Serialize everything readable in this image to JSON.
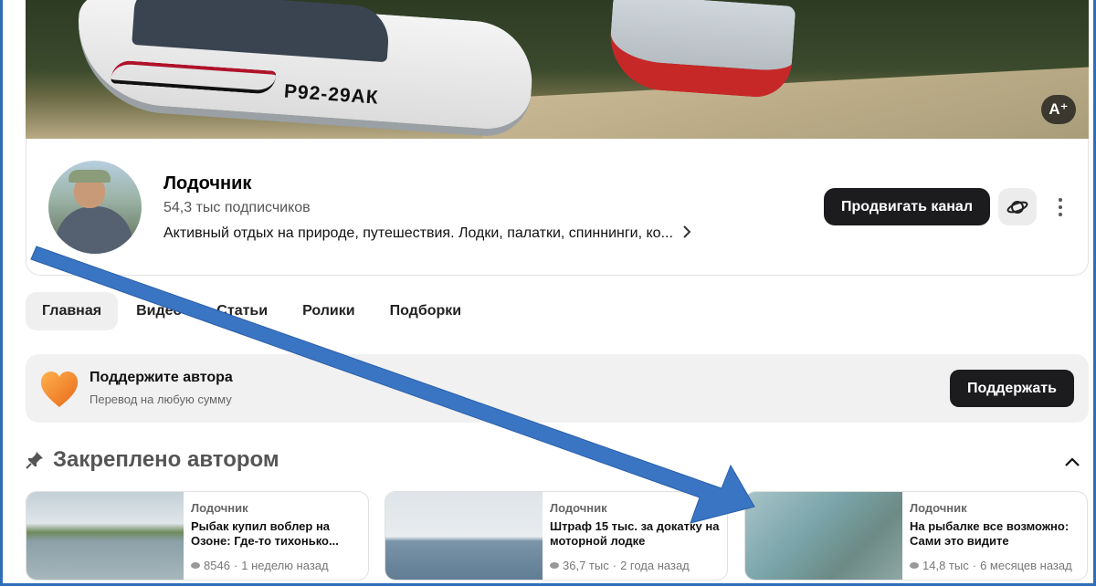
{
  "banner": {
    "plate": "Р92-29АК",
    "ai_badge": "A⁺"
  },
  "channel": {
    "name": "Лодочник",
    "subscribers": "54,3 тыс подписчиков",
    "description": "Активный отдых на природе, путешествия. Лодки, палатки, спиннинги, ко...",
    "promote_label": "Продвигать канал"
  },
  "tabs": [
    {
      "label": "Главная"
    },
    {
      "label": "Видео"
    },
    {
      "label": "Статьи"
    },
    {
      "label": "Ролики"
    },
    {
      "label": "Подборки"
    }
  ],
  "support": {
    "title": "Поддержите автора",
    "subtitle": "Перевод на любую сумму",
    "button": "Поддержать"
  },
  "pinned": {
    "title": "Закреплено автором",
    "cards": [
      {
        "author": "Лодочник",
        "title": "Рыбак купил воблер на Озоне: Где-то тихонько...",
        "views": "8546",
        "time": "1 неделю назад"
      },
      {
        "author": "Лодочник",
        "title": "Штраф 15 тыс. за докатку на моторной лодке",
        "views": "36,7 тыс",
        "time": "2 года назад"
      },
      {
        "author": "Лодочник",
        "title": "На рыбалке все возможно: Сами это видите",
        "views": "14,8 тыс",
        "time": "6 месяцев назад"
      }
    ]
  },
  "colors": {
    "accent_dark": "#1c1c1f",
    "arrow": "#3a75c4",
    "frame": "#2f6db8",
    "heart": "#f08a24"
  }
}
